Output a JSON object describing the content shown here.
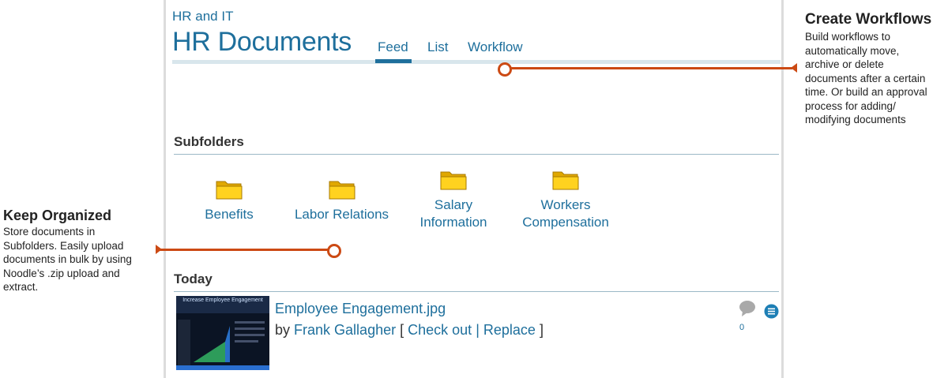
{
  "header": {
    "breadcrumb": "HR and IT",
    "title": "HR Documents",
    "tabs": [
      {
        "label": "Feed",
        "active": true
      },
      {
        "label": "List",
        "active": false
      },
      {
        "label": "Workflow",
        "active": false
      }
    ]
  },
  "subfolders": {
    "heading": "Subfolders",
    "items": [
      {
        "line1": "Benefits",
        "line2": ""
      },
      {
        "line1": "Labor Relations",
        "line2": ""
      },
      {
        "line1": "Salary",
        "line2": "Information"
      },
      {
        "line1": "Workers",
        "line2": "Compensation"
      }
    ]
  },
  "feed": {
    "heading": "Today",
    "item": {
      "thumbnail_title": "Increase Employee Engagement",
      "filename": "Employee Engagement.jpg",
      "by_prefix": "by",
      "author": "Frank Gallagher",
      "open_bracket": "[",
      "checkout": "Check out",
      "separator": "|",
      "replace": "Replace",
      "close_bracket": "]",
      "comment_count": "0"
    }
  },
  "callouts": {
    "workflows": {
      "title": "Create Workflows",
      "body": [
        "Build workflows to",
        "automatically move,",
        "archive or delete",
        "documents after a certain",
        "time. Or build an approval",
        "process for adding/",
        "modifying documents"
      ]
    },
    "organized": {
      "title": "Keep Organized",
      "body": [
        "Store documents in",
        "Subfolders. Easily upload",
        "documents in bulk by using",
        "Noodle’s .zip upload and",
        "extract."
      ]
    }
  },
  "colors": {
    "accent": "#1e6f9c",
    "leader": "#cc4a14",
    "folder": "#f2c200"
  }
}
